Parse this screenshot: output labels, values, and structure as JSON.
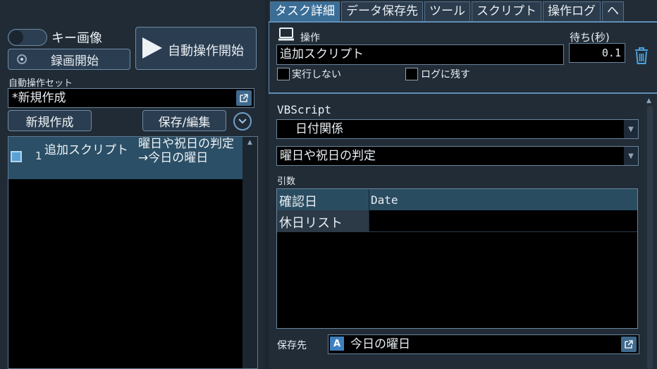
{
  "left": {
    "key_image_label": "キー画像",
    "record_label": "録画開始",
    "auto_start_label": "自動操作開始",
    "set_label": "自動操作セット",
    "set_value": "*新規作成",
    "new_label": "新規作成",
    "save_edit_label": "保存/編集",
    "list": [
      {
        "num": "1",
        "name": "追加スクリプト",
        "desc": "曜日や祝日の判定\n→今日の曜日"
      }
    ]
  },
  "tabs": [
    "タスク詳細",
    "データ保存先",
    "ツール",
    "スクリプト",
    "操作ログ",
    "ヘ"
  ],
  "detail": {
    "op_label": "操作",
    "op_value": "追加スクリプト",
    "wait_label": "待ち(秒)",
    "wait_value": "0.1",
    "no_exec_label": "実行しない",
    "keep_log_label": "ログに残す",
    "vbscript_label": "VBScript",
    "category_value": "日付関係",
    "function_value": "曜日や祝日の判定",
    "args_label": "引数",
    "args": [
      {
        "name": "確認日",
        "value": "Date"
      },
      {
        "name": "休日リスト",
        "value": ""
      }
    ],
    "save_to_label": "保存先",
    "save_to_badge": "A",
    "save_to_value": "今日の曜日"
  },
  "colors": {
    "accent": "#3a6e97",
    "selected_row": "#2b4f66",
    "background": "#1f2a35"
  }
}
